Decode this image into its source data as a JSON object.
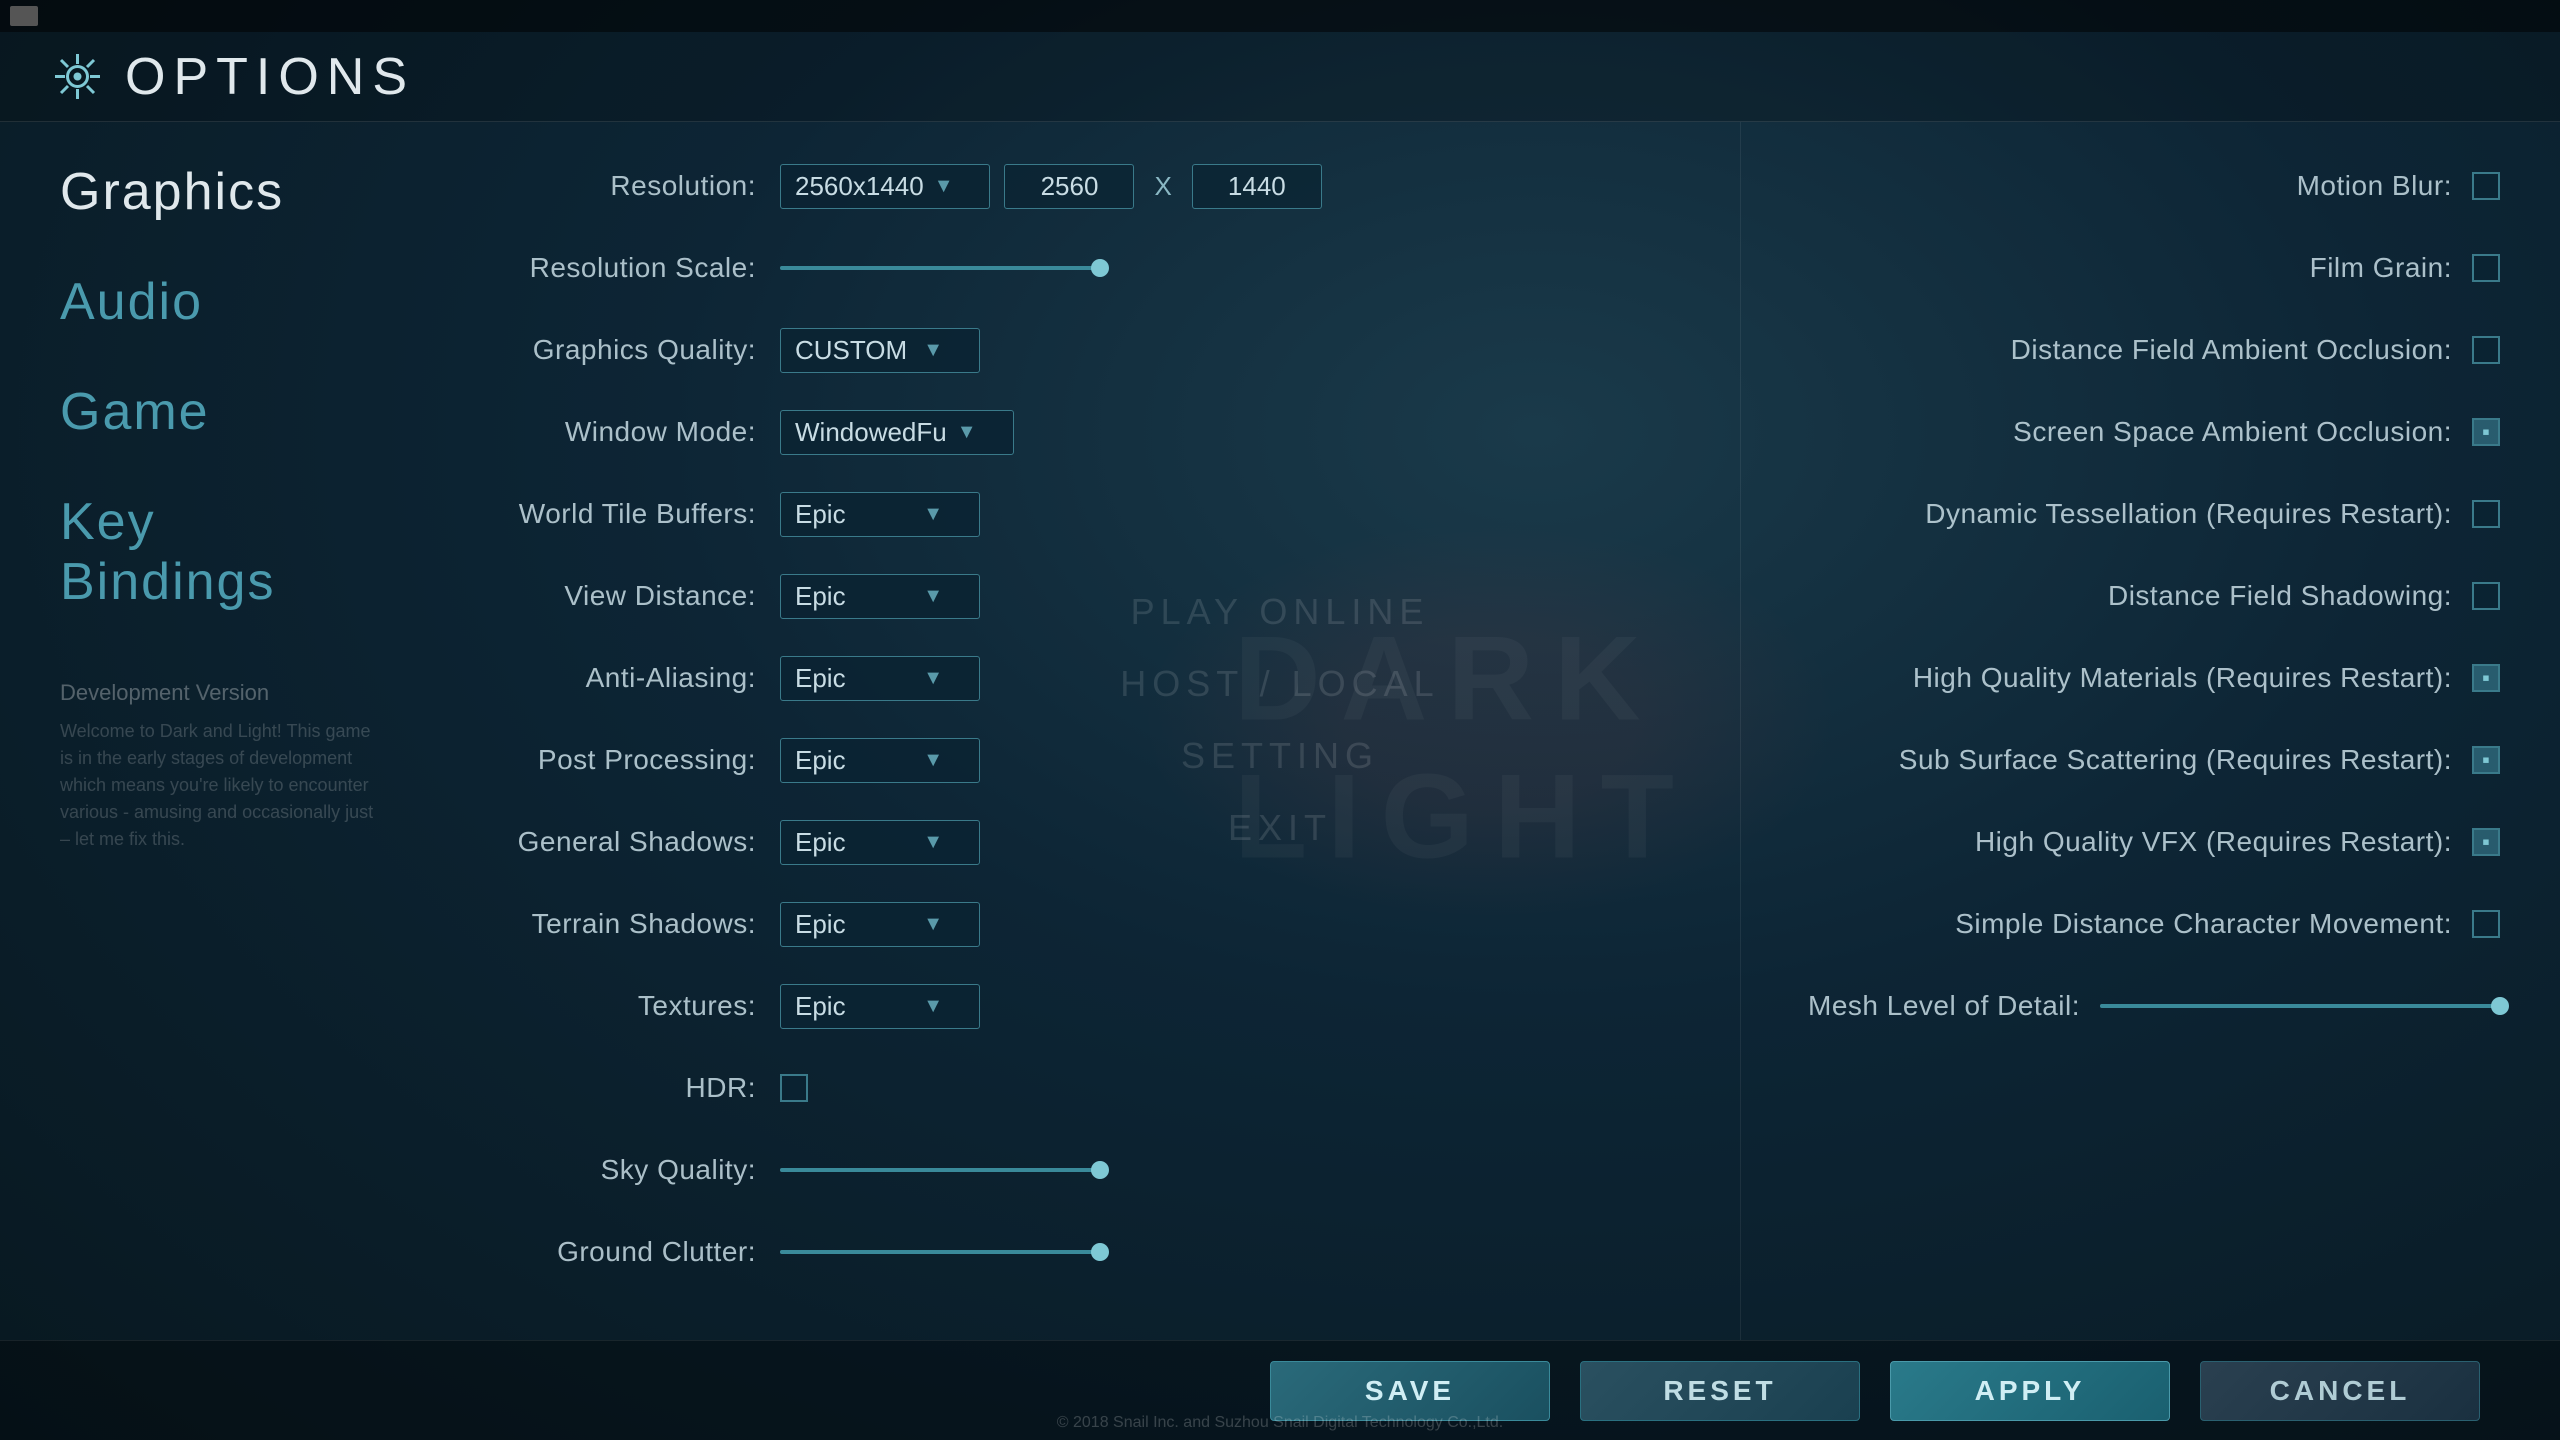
{
  "header": {
    "title": "OPTIONS",
    "icon": "⚙"
  },
  "sidebar": {
    "items": [
      {
        "id": "graphics",
        "label": "Graphics",
        "state": "active"
      },
      {
        "id": "audio",
        "label": "Audio",
        "state": "inactive"
      },
      {
        "id": "game",
        "label": "Game",
        "state": "inactive"
      },
      {
        "id": "keybindings",
        "label": "Key Bindings",
        "state": "inactive"
      }
    ],
    "dev_version_title": "Development Version",
    "dev_version_text": "Welcome to Dark and Light! This game is in the early stages of development which means you're likely to encounter various - amusing and occasionally just – let me fix this."
  },
  "settings_left": {
    "rows": [
      {
        "id": "resolution",
        "label": "Resolution:",
        "type": "resolution",
        "dropdown_value": "2560x1440",
        "val1": "2560",
        "val2": "1440"
      },
      {
        "id": "resolution_scale",
        "label": "Resolution Scale:",
        "type": "slider",
        "fill_pct": 100
      },
      {
        "id": "graphics_quality",
        "label": "Graphics Quality:",
        "type": "dropdown",
        "value": "CUSTOM"
      },
      {
        "id": "window_mode",
        "label": "Window Mode:",
        "type": "dropdown",
        "value": "WindowedFu"
      },
      {
        "id": "world_tile_buffers",
        "label": "World Tile Buffers:",
        "type": "dropdown",
        "value": "Epic"
      },
      {
        "id": "view_distance",
        "label": "View Distance:",
        "type": "dropdown",
        "value": "Epic"
      },
      {
        "id": "anti_aliasing",
        "label": "Anti-Aliasing:",
        "type": "dropdown",
        "value": "Epic"
      },
      {
        "id": "post_processing",
        "label": "Post Processing:",
        "type": "dropdown",
        "value": "Epic"
      },
      {
        "id": "general_shadows",
        "label": "General Shadows:",
        "type": "dropdown",
        "value": "Epic"
      },
      {
        "id": "terrain_shadows",
        "label": "Terrain Shadows:",
        "type": "dropdown",
        "value": "Epic"
      },
      {
        "id": "textures",
        "label": "Textures:",
        "type": "dropdown",
        "value": "Epic"
      },
      {
        "id": "hdr",
        "label": "HDR:",
        "type": "checkbox",
        "checked": false
      },
      {
        "id": "sky_quality",
        "label": "Sky Quality:",
        "type": "slider",
        "fill_pct": 100
      },
      {
        "id": "ground_clutter",
        "label": "Ground Clutter:",
        "type": "slider",
        "fill_pct": 100
      }
    ]
  },
  "settings_right": {
    "rows": [
      {
        "id": "motion_blur",
        "label": "Motion Blur:",
        "type": "checkbox",
        "checked": false
      },
      {
        "id": "film_grain",
        "label": "Film Grain:",
        "type": "checkbox",
        "checked": false
      },
      {
        "id": "distance_field_ao",
        "label": "Distance Field Ambient Occlusion:",
        "type": "checkbox",
        "checked": false
      },
      {
        "id": "screen_space_ao",
        "label": "Screen Space Ambient Occlusion:",
        "type": "checkbox",
        "checked": true,
        "style": "filled"
      },
      {
        "id": "dynamic_tess",
        "label": "Dynamic Tessellation (Requires Restart):",
        "type": "checkbox",
        "checked": false
      },
      {
        "id": "distance_field_shadow",
        "label": "Distance Field Shadowing:",
        "type": "checkbox",
        "checked": false
      },
      {
        "id": "hq_materials",
        "label": "High Quality Materials (Requires Restart):",
        "type": "checkbox",
        "checked": true,
        "style": "filled"
      },
      {
        "id": "subsurface_scatter",
        "label": "Sub Surface Scattering (Requires Restart):",
        "type": "checkbox",
        "checked": true,
        "style": "filled"
      },
      {
        "id": "hq_vfx",
        "label": "High Quality VFX (Requires Restart):",
        "type": "checkbox",
        "checked": true,
        "style": "filled"
      },
      {
        "id": "simple_distance",
        "label": "Simple Distance Character Movement:",
        "type": "checkbox",
        "checked": false
      },
      {
        "id": "mesh_lod",
        "label": "Mesh Level of Detail:",
        "type": "slider",
        "fill_pct": 100
      }
    ]
  },
  "center_menu": {
    "items": [
      {
        "label": "PLAY ONLINE"
      },
      {
        "label": "HOST / LOCAL"
      },
      {
        "label": "SETTING"
      },
      {
        "label": "EXIT"
      }
    ]
  },
  "bottom_bar": {
    "save_label": "SAVE",
    "reset_label": "RESET",
    "apply_label": "APPLY",
    "cancel_label": "CANCEL"
  },
  "copyright": "© 2018 Snail Inc. and Suzhou Snail Digital Technology Co.,Ltd."
}
